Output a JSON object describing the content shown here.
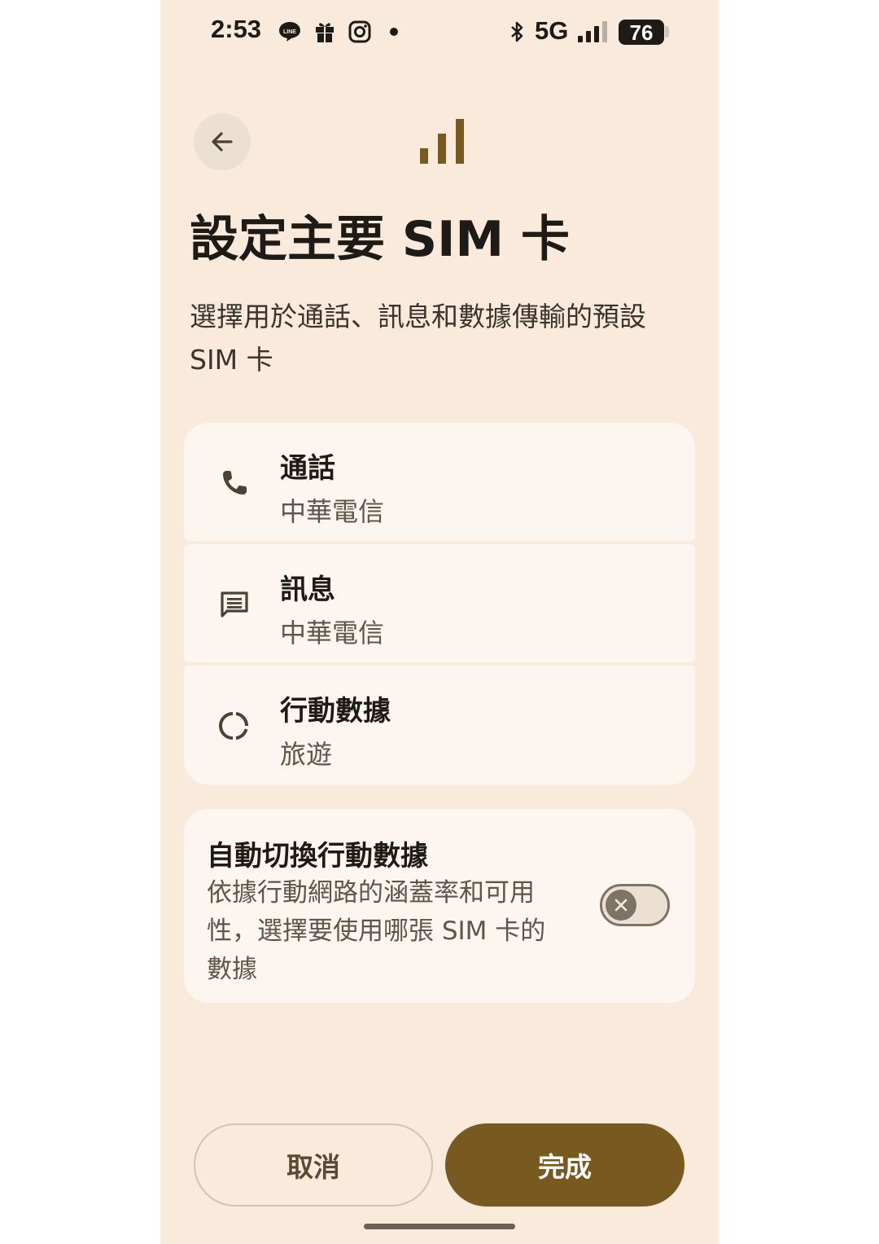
{
  "status_bar": {
    "time": "2:53",
    "network": "5G",
    "battery": "76",
    "icons": [
      "line-icon",
      "gift-icon",
      "instagram-icon",
      "notification-dot",
      "bluetooth-icon",
      "signal-icon"
    ]
  },
  "header": {
    "back_icon": "arrow-back-icon",
    "hero_icon": "signal-bars-icon"
  },
  "page": {
    "title": "設定主要 SIM 卡",
    "subtitle": "選擇用於通話、訊息和數據傳輸的預設 SIM 卡"
  },
  "sim_settings": [
    {
      "label": "通話",
      "value": "中華電信",
      "icon": "phone-icon"
    },
    {
      "label": "訊息",
      "value": "中華電信",
      "icon": "message-icon"
    },
    {
      "label": "行動數據",
      "value": "旅遊",
      "icon": "data-usage-icon"
    }
  ],
  "auto_switch": {
    "title": "自動切換行動數據",
    "description": "依據行動網路的涵蓋率和可用性，選擇要使用哪張 SIM 卡的數據",
    "enabled": false
  },
  "actions": {
    "cancel_label": "取消",
    "done_label": "完成"
  },
  "colors": {
    "background": "#f9eadb",
    "card": "#fdf5ef",
    "accent": "#785a20",
    "text": "#1e1b16"
  }
}
